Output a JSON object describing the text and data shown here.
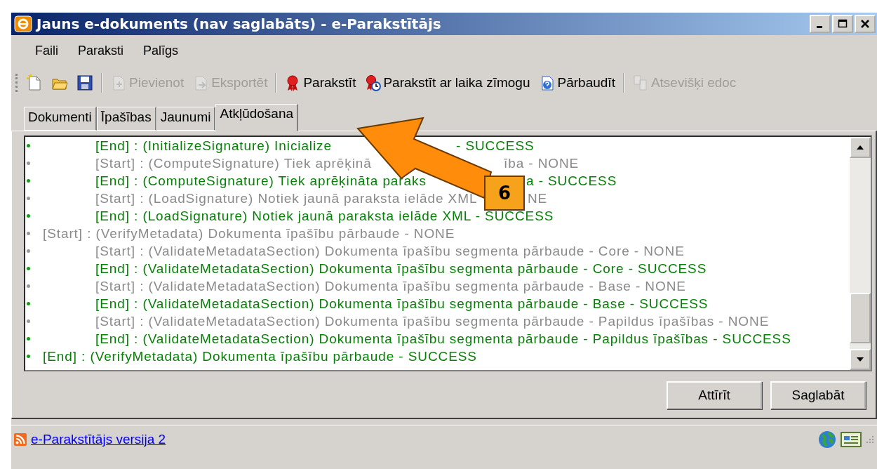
{
  "window": {
    "title": "Jauns e-dokuments (nav saglabāts) - e-Parakstītājs"
  },
  "menu": [
    "Faili",
    "Paraksti",
    "Palīgs"
  ],
  "toolbar": [
    {
      "kind": "icon",
      "disabled": false
    },
    {
      "kind": "icon",
      "disabled": false
    },
    {
      "kind": "icon",
      "disabled": false
    },
    {
      "kind": "separator"
    },
    {
      "kind": "button",
      "label": "Pievienot",
      "disabled": true
    },
    {
      "kind": "button",
      "label": "Eksportēt",
      "disabled": true
    },
    {
      "kind": "separator"
    },
    {
      "kind": "button",
      "label": "Parakstīt",
      "disabled": false
    },
    {
      "kind": "button",
      "label": "Parakstīt ar laika zīmogu",
      "disabled": false
    },
    {
      "kind": "button",
      "label": "Pārbaudīt",
      "disabled": false
    },
    {
      "kind": "separator"
    },
    {
      "kind": "button",
      "label": "Atsevišķi edoc",
      "disabled": true
    }
  ],
  "tabs": [
    {
      "label": "Dokumenti",
      "selected": false
    },
    {
      "label": "Īpašības",
      "selected": false
    },
    {
      "label": "Jaunumi",
      "selected": false
    },
    {
      "label": "Atkļūdošana",
      "selected": true
    }
  ],
  "log": [
    {
      "children": [
        {
          "kind": "end",
          "text": "[End] : (InitializeSignature) Inicialize",
          "tail": "- SUCCESS"
        },
        {
          "kind": "start",
          "text": "[Start] : (ComputeSignature) Tiek aprēķinā",
          "tail": "ība - NONE"
        },
        {
          "kind": "end",
          "text": "[End] : (ComputeSignature) Tiek aprēķināta paraks",
          "tail": "a - SUCCESS"
        },
        {
          "kind": "start",
          "text": "[Start] : (LoadSignature) Notiek jaunā paraksta ielāde XML",
          "tail": "NE"
        },
        {
          "kind": "end",
          "text": "[End] : (LoadSignature) Notiek jaunā paraksta ielāde XML - SUCCESS"
        }
      ]
    },
    {
      "kind": "start",
      "text": "[Start] : (VerifyMetadata) Dokumenta īpašību pārbaude - NONE"
    },
    {
      "children": [
        {
          "kind": "start",
          "text": "[Start] : (ValidateMetadataSection) Dokumenta īpašību segmenta pārbaude - Core - NONE"
        },
        {
          "kind": "end",
          "text": "[End] : (ValidateMetadataSection) Dokumenta īpašību segmenta pārbaude - Core - SUCCESS"
        },
        {
          "kind": "start",
          "text": "[Start] : (ValidateMetadataSection) Dokumenta īpašību segmenta pārbaude - Base - NONE"
        },
        {
          "kind": "end",
          "text": "[End] : (ValidateMetadataSection) Dokumenta īpašību segmenta pārbaude - Base - SUCCESS"
        },
        {
          "kind": "start",
          "text": "[Start] : (ValidateMetadataSection) Dokumenta īpašību segmenta pārbaude - Papildus īpašības - NONE"
        },
        {
          "kind": "end",
          "text": "[End] : (ValidateMetadataSection) Dokumenta īpašību segmenta pārbaude - Papildus īpašības - SUCCESS"
        }
      ]
    },
    {
      "kind": "end",
      "text": "[End] : (VerifyMetadata) Dokumenta īpašību pārbaude - SUCCESS"
    }
  ],
  "buttons": [
    "Attīrīt",
    "Saglabāt"
  ],
  "status_bar": {
    "link": "e-Parakstītājs versija 2"
  },
  "callout": {
    "number": "6"
  }
}
